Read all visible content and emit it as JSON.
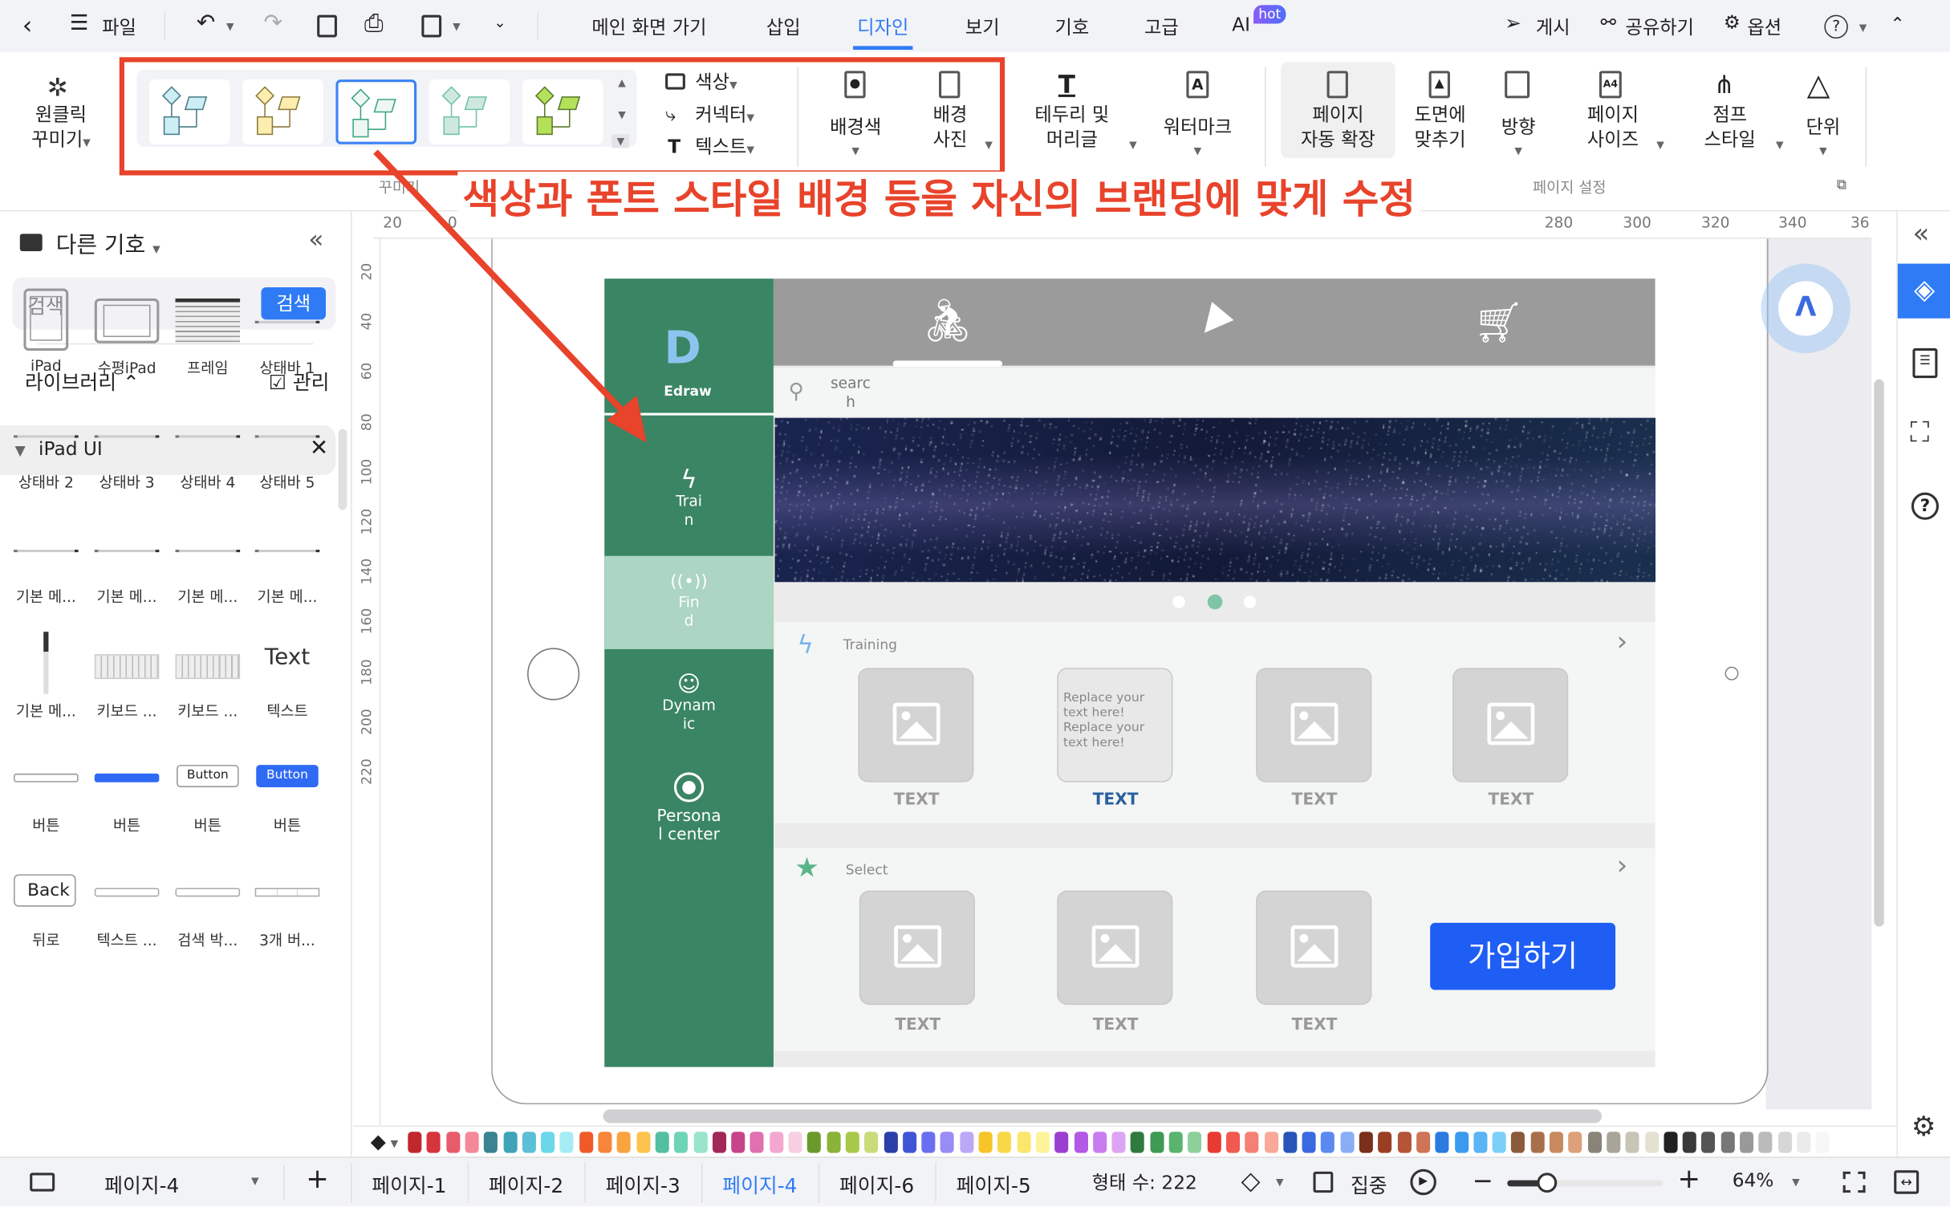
{
  "topbar": {
    "file": "파일",
    "menus": [
      "메인 화면 가기",
      "삽입",
      "디자인",
      "보기",
      "기호",
      "고급",
      "AI"
    ],
    "active_menu": "디자인",
    "hot_badge": "hot",
    "publish": "게시",
    "share": "공유하기",
    "options": "옵션"
  },
  "ribbon": {
    "one_click": [
      "원클릭",
      "꾸미기"
    ],
    "color": "색상",
    "connector": "커넥터",
    "text": "텍스트",
    "bg_color": "배경색",
    "bg_image": [
      "배경",
      "사진"
    ],
    "border_header": [
      "테두리 및",
      "머리글"
    ],
    "watermark": "워터마크",
    "auto_expand": [
      "페이지",
      "자동 확장"
    ],
    "fit": [
      "도면에",
      "맞추기"
    ],
    "orientation": "방향",
    "page_size": [
      "페이지",
      "사이즈"
    ],
    "jump_style": [
      "점프",
      "스타일"
    ],
    "unit": "단위",
    "group_beautify": "꾸미기",
    "group_page_setup": "페이지 설정",
    "themes": [
      {
        "fill": "#cdeef5",
        "stroke": "#4a7a86"
      },
      {
        "fill": "#fdeeb0",
        "stroke": "#8a7a3a"
      },
      {
        "fill": "#eef7f3",
        "stroke": "#3aa57e"
      },
      {
        "fill": "#cfe8df",
        "stroke": "#6fc3a5"
      },
      {
        "fill": "#b5e05a",
        "stroke": "#5a7a2a"
      }
    ],
    "selected_theme": 2
  },
  "annotation": {
    "text": "색상과 폰트 스타일 배경 등을 자신의 브랜딩에 맞게 수정",
    "color": "#e8432b"
  },
  "left_panel": {
    "title": "다른 기호",
    "search_placeholder": "검색",
    "search_button": "검색",
    "library": "라이브러리",
    "manage": "관리",
    "category": "iPad UI",
    "items": [
      {
        "label": "iPad",
        "thumb": "ipad"
      },
      {
        "label": "수평iPad",
        "thumb": "ipad-h"
      },
      {
        "label": "프레임",
        "thumb": "frame"
      },
      {
        "label": "상태바 1",
        "thumb": "bar"
      },
      {
        "label": "상태바 2",
        "thumb": "bar"
      },
      {
        "label": "상태바 3",
        "thumb": "bar"
      },
      {
        "label": "상태바 4",
        "thumb": "bar"
      },
      {
        "label": "상태바 5",
        "thumb": "bar"
      },
      {
        "label": "기본 메...",
        "thumb": "bar"
      },
      {
        "label": "기본 메...",
        "thumb": "bar"
      },
      {
        "label": "기본 메...",
        "thumb": "bar"
      },
      {
        "label": "기본 메...",
        "thumb": "bar"
      },
      {
        "label": "기본 메...",
        "thumb": "vbar"
      },
      {
        "label": "키보드 ...",
        "thumb": "keyboard"
      },
      {
        "label": "키보드 ...",
        "thumb": "keyboard"
      },
      {
        "label": "텍스트",
        "thumb": "text",
        "text": "Text"
      },
      {
        "label": "버튼",
        "thumb": "btn-outline-sm"
      },
      {
        "label": "버튼",
        "thumb": "btn-blue-sm"
      },
      {
        "label": "버튼",
        "thumb": "btn-outline",
        "text": "Button"
      },
      {
        "label": "버튼",
        "thumb": "btn-blue",
        "text": "Button"
      },
      {
        "label": "뒤로",
        "thumb": "back",
        "text": "Back"
      },
      {
        "label": "텍스트 ...",
        "thumb": "field"
      },
      {
        "label": "검색 박...",
        "thumb": "field"
      },
      {
        "label": "3개 버...",
        "thumb": "seg"
      }
    ]
  },
  "ruler": {
    "top": [
      "20",
      "0",
      "280",
      "300",
      "320",
      "340",
      "36"
    ],
    "left": [
      "20",
      "40",
      "60",
      "80",
      "100",
      "120",
      "140",
      "160",
      "180",
      "200",
      "220"
    ]
  },
  "mockup": {
    "logo_text": "Edraw",
    "nav": [
      {
        "label": "Trai n",
        "icon": "bolt-icon"
      },
      {
        "label": "Fin d",
        "icon": "broadcast-icon"
      },
      {
        "label": "Dynam ic",
        "icon": "smiley-icon"
      },
      {
        "label": "Persona l center",
        "icon": "person-icon"
      }
    ],
    "selected_nav": 1,
    "search_placeholder": "searc h",
    "section1_title": "Training",
    "section2_title": "Select",
    "card_text": "TEXT",
    "placeholder_text": "Replace your text here! Replace your text here!",
    "join_button": "가입하기",
    "colors": {
      "sidebar": "#3a8564",
      "selected": "#acd5c3",
      "topbar": "#9b9b9b",
      "button": "#1f5ef5",
      "dot_active": "#7fc4a6"
    }
  },
  "palette": [
    "#c0282d",
    "#d8343c",
    "#e85b6a",
    "#f48a98",
    "#3a8391",
    "#3fa4b8",
    "#5bc0d6",
    "#6ad8ea",
    "#a6ecf5",
    "#f05a28",
    "#f7853a",
    "#f9a43e",
    "#fbc44e",
    "#52bfa0",
    "#6ed4b6",
    "#98e4cc",
    "#a3285a",
    "#c8448a",
    "#e070b0",
    "#f4a8cf",
    "#f7cfe3",
    "#6b9a2a",
    "#8ab33a",
    "#a8c84a",
    "#c8dc7a",
    "#2a3fa8",
    "#4055d6",
    "#6a6ff0",
    "#9a8cf5",
    "#bda8f8",
    "#f7c52a",
    "#f9d848",
    "#fbe66e",
    "#fdf39a",
    "#9a3fd0",
    "#b458e6",
    "#c97cf0",
    "#dda4f5",
    "#2f7a3f",
    "#3f9a52",
    "#5ab46e",
    "#8ed09a",
    "#e83a30",
    "#f05a50",
    "#f58074",
    "#f9a89a",
    "#2a55b8",
    "#3a6ae0",
    "#5a8af0",
    "#8aaef5",
    "#7a2f1a",
    "#9a3f24",
    "#b4553a",
    "#cf7456",
    "#2a7ae0",
    "#3a9af0",
    "#5ab4f5",
    "#7ad0f8",
    "#8a5a3a",
    "#a8704a",
    "#c88a5e",
    "#dda07a",
    "#8a8478",
    "#a8a498",
    "#c8c4b6",
    "#e4e0d2",
    "#222222",
    "#3a3a3a",
    "#555555",
    "#777777",
    "#999999",
    "#bbbbbb",
    "#d6d6d6",
    "#ebebeb",
    "#f6f6f6"
  ],
  "bottom": {
    "current_page": "페이지-4",
    "pages": [
      "페이지-1",
      "페이지-2",
      "페이지-3",
      "페이지-4",
      "페이지-6",
      "페이지-5"
    ],
    "active_page": "페이지-4",
    "shape_count": "형태 수: 222",
    "focus": "집중",
    "zoom": "64%",
    "zoom_level": 0.64
  }
}
